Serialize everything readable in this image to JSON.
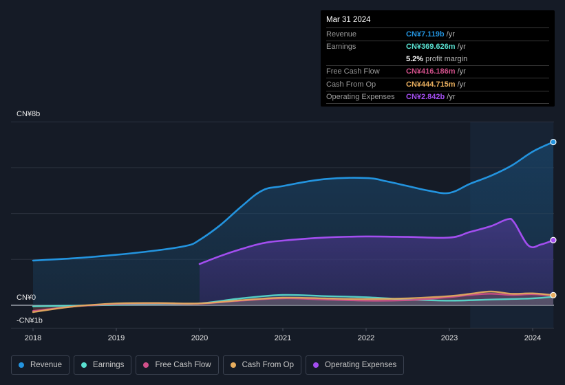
{
  "tooltip": {
    "date": "Mar 31 2024",
    "rows": [
      {
        "label": "Revenue",
        "value": "CN¥7.119b",
        "unit": "/yr",
        "color": "#2394df"
      },
      {
        "label": "Earnings",
        "value": "CN¥369.626m",
        "unit": "/yr",
        "color": "#59e0d0"
      },
      {
        "label": "",
        "value": "5.2%",
        "unit": "profit margin",
        "color": "#ffffff"
      },
      {
        "label": "Free Cash Flow",
        "value": "CN¥416.186m",
        "unit": "/yr",
        "color": "#d1508a"
      },
      {
        "label": "Cash From Op",
        "value": "CN¥444.715m",
        "unit": "/yr",
        "color": "#e8ae5e"
      },
      {
        "label": "Operating Expenses",
        "value": "CN¥2.842b",
        "unit": "/yr",
        "color": "#a34ef0"
      }
    ]
  },
  "legend": [
    {
      "label": "Revenue",
      "color": "#2394df"
    },
    {
      "label": "Earnings",
      "color": "#59e0d0"
    },
    {
      "label": "Free Cash Flow",
      "color": "#d1508a"
    },
    {
      "label": "Cash From Op",
      "color": "#e8ae5e"
    },
    {
      "label": "Operating Expenses",
      "color": "#a34ef0"
    }
  ],
  "chart_data": {
    "type": "area",
    "title": "",
    "xlabel": "",
    "ylabel": "",
    "unit": "CN¥ billions",
    "ylim": [
      -1,
      8
    ],
    "xlim": [
      2017.8,
      2024.3
    ],
    "y_tick_labels": [
      {
        "value": 8,
        "label": "CN¥8b"
      },
      {
        "value": 0,
        "label": "CN¥0"
      },
      {
        "value": -1,
        "label": "-CN¥1b"
      }
    ],
    "y_gridlines": [
      8,
      6,
      4,
      2,
      0,
      -1
    ],
    "x_ticks": [
      2018,
      2019,
      2020,
      2021,
      2022,
      2023,
      2024
    ],
    "x_tick_labels": [
      "2018",
      "2019",
      "2020",
      "2021",
      "2022",
      "2023",
      "2024"
    ],
    "highlight_range": [
      2023.25,
      2024.25
    ],
    "grid": true,
    "legend_position": "bottom-left",
    "series": [
      {
        "name": "Revenue",
        "color": "#2394df",
        "fill": true,
        "x": [
          2018.0,
          2018.5,
          2019.0,
          2019.5,
          2019.85,
          2020.0,
          2020.25,
          2020.5,
          2020.75,
          2021.0,
          2021.5,
          2022.0,
          2022.25,
          2022.5,
          2022.75,
          2023.0,
          2023.25,
          2023.5,
          2023.75,
          2024.0,
          2024.25
        ],
        "values": [
          1.95,
          2.05,
          2.2,
          2.4,
          2.6,
          2.85,
          3.5,
          4.3,
          5.0,
          5.2,
          5.5,
          5.55,
          5.4,
          5.2,
          5.0,
          4.9,
          5.3,
          5.65,
          6.1,
          6.7,
          7.12
        ]
      },
      {
        "name": "Operating Expenses",
        "color": "#a34ef0",
        "fill": true,
        "x": [
          2020.0,
          2020.25,
          2020.5,
          2020.75,
          2021.0,
          2021.5,
          2022.0,
          2022.5,
          2023.0,
          2023.25,
          2023.5,
          2023.7,
          2023.78,
          2023.95,
          2024.1,
          2024.25
        ],
        "values": [
          1.8,
          2.15,
          2.45,
          2.7,
          2.82,
          2.95,
          3.0,
          2.98,
          2.95,
          3.2,
          3.45,
          3.75,
          3.6,
          2.6,
          2.65,
          2.84
        ]
      },
      {
        "name": "Earnings",
        "color": "#59e0d0",
        "fill": false,
        "x": [
          2018.0,
          2018.5,
          2019.0,
          2019.5,
          2020.0,
          2020.5,
          2021.0,
          2021.5,
          2022.0,
          2022.5,
          2023.0,
          2023.5,
          2024.0,
          2024.25
        ],
        "values": [
          -0.05,
          -0.02,
          0.02,
          0.05,
          0.08,
          0.3,
          0.45,
          0.4,
          0.35,
          0.25,
          0.2,
          0.25,
          0.3,
          0.37
        ]
      },
      {
        "name": "Free Cash Flow",
        "color": "#d1508a",
        "fill": false,
        "x": [
          2018.0,
          2018.5,
          2019.0,
          2019.5,
          2020.0,
          2020.5,
          2021.0,
          2021.5,
          2022.0,
          2022.5,
          2023.0,
          2023.25,
          2023.5,
          2023.75,
          2024.0,
          2024.25
        ],
        "values": [
          -0.25,
          -0.05,
          0.05,
          0.08,
          0.07,
          0.2,
          0.3,
          0.25,
          0.2,
          0.22,
          0.35,
          0.45,
          0.5,
          0.45,
          0.48,
          0.42
        ]
      },
      {
        "name": "Cash From Op",
        "color": "#e8ae5e",
        "fill": false,
        "x": [
          2018.0,
          2018.5,
          2019.0,
          2019.5,
          2020.0,
          2020.5,
          2021.0,
          2021.5,
          2022.0,
          2022.5,
          2023.0,
          2023.25,
          2023.5,
          2023.75,
          2024.0,
          2024.25
        ],
        "values": [
          -0.3,
          -0.05,
          0.08,
          0.1,
          0.08,
          0.22,
          0.33,
          0.3,
          0.27,
          0.3,
          0.4,
          0.5,
          0.6,
          0.5,
          0.52,
          0.44
        ]
      }
    ]
  }
}
